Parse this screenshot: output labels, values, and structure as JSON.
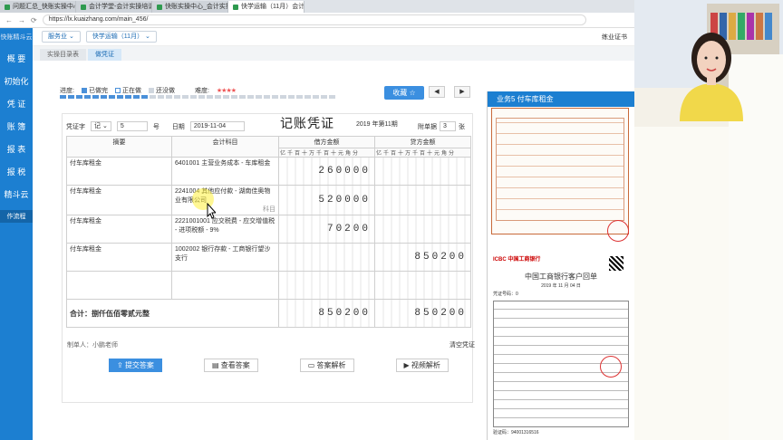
{
  "browser": {
    "tabs": [
      {
        "label": "问题汇总_快账实操中心...",
        "active": false
      },
      {
        "label": "会计学堂-会计实操培训...",
        "active": false
      },
      {
        "label": "快账实操中心_会计实操...",
        "active": false
      },
      {
        "label": "快学运输（11月）会计实...",
        "active": true
      }
    ],
    "url": "https://lx.kuaizhang.com/main_456/"
  },
  "sidebar": {
    "brand": "快账精斗云",
    "items": [
      {
        "label": "概  要"
      },
      {
        "label": "初始化"
      },
      {
        "label": "凭  证"
      },
      {
        "label": "账  簿"
      },
      {
        "label": "报  表"
      },
      {
        "label": "报  税"
      },
      {
        "label": "精斗云"
      }
    ],
    "flow": "作流程"
  },
  "topbar": {
    "service_dd": "服务业",
    "company_dd": "快学运输（11月）",
    "right_text": "练业证书"
  },
  "crumbs": [
    {
      "label": "实操目录表",
      "active": false
    },
    {
      "label": "做凭证",
      "active": true
    }
  ],
  "progress": {
    "label": "进度:",
    "done": "已做完",
    "doing": "正在做",
    "todo": "还没做",
    "difficulty": "难度:",
    "stars": "★★★★",
    "completed_fraction": 0.33
  },
  "collect_btn": "收藏 ☆",
  "voucher": {
    "title": "记账凭证",
    "period": "2019 年第11期",
    "word_label": "凭证字",
    "word": "记",
    "number": "5",
    "number_unit": "号",
    "date_label": "日期",
    "date": "2019-11-04",
    "attach_label": "附单据",
    "attach": "3",
    "attach_unit": "张",
    "col_summary": "摘要",
    "col_subject": "会计科目",
    "col_debit": "借方金额",
    "col_credit": "贷方金额",
    "digit_header": "亿千百十万千百十元角分",
    "rows": [
      {
        "summary": "付车库租金",
        "subject": "6401001 主营业务成本 - 车库租金",
        "debit": "260000",
        "credit": ""
      },
      {
        "summary": "付车库租金",
        "subject": "2241004 其他应付款 - 湖南佳奥物业有限公司",
        "hint": "科目",
        "debit": "520000",
        "credit": ""
      },
      {
        "summary": "付车库租金",
        "subject": "2221001001 应交税费 - 应交增值税 - 进项税额 - 9%",
        "debit": "70200",
        "credit": ""
      },
      {
        "summary": "付车库租金",
        "subject": "1002002 银行存款 - 工商银行望沙支行",
        "debit": "",
        "credit": "850200"
      },
      {
        "summary": "",
        "subject": "",
        "debit": "",
        "credit": ""
      }
    ],
    "total_label": "合计：捌仟伍佰零贰元整",
    "total_debit": "850200",
    "total_credit": "850200",
    "maker": "制单人：小鹏老师",
    "clear": "清空凭证"
  },
  "buttons": {
    "submit": "提交答案",
    "view_answer": "查看答案",
    "analysis": "答案解析",
    "video": "视频解析"
  },
  "right_panel": {
    "title": "业务5 付车库租金",
    "receipt": {
      "bank": "ICBC 中国工商银行",
      "title": "中国工商银行客户回单",
      "date": "2019 年 11 月 04 日",
      "voucher_no": "凭证号码：0",
      "check_no": "验证码：94001316516"
    }
  },
  "colors": {
    "accent": "#1c7fd1",
    "button": "#3b8fe0"
  }
}
